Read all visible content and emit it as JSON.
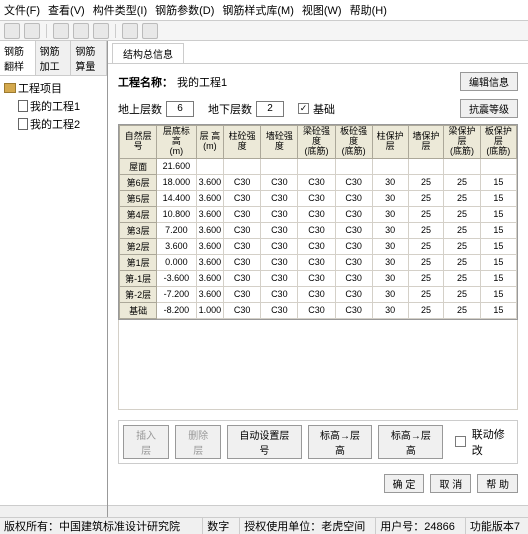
{
  "menu": [
    "文件(F)",
    "查看(V)",
    "构件类型(I)",
    "钢筋参数(D)",
    "钢筋样式库(M)",
    "视图(W)",
    "帮助(H)"
  ],
  "leftTabs": [
    "钢筋翻样",
    "钢筋加工",
    "钢筋算量"
  ],
  "treeRoot": "工程项目",
  "treeItems": [
    "我的工程1",
    "我的工程2"
  ],
  "rightTab": "结构总信息",
  "projLabel": "工程名称：",
  "projName": "我的工程1",
  "editBtn": "编辑信息",
  "aboveLabel": "地上层数",
  "aboveVal": "6",
  "belowLabel": "地下层数",
  "belowVal": "2",
  "baseLabel": "基础",
  "seismicBtn": "抗震等级",
  "headers": [
    "自然层号",
    "层底标高\n(m)",
    "层 高\n(m)",
    "柱砼强度",
    "墙砼强度",
    "梁砼强度\n(底筋)",
    "板砼强度\n(底筋)",
    "柱保护层",
    "墙保护层",
    "梁保护层\n(底筋)",
    "板保护层\n(底筋)"
  ],
  "rows": [
    {
      "h": "屋面",
      "c": [
        "21.600",
        "",
        "",
        "",
        "",
        "",
        "",
        "",
        "",
        ""
      ]
    },
    {
      "h": "第6层",
      "c": [
        "18.000",
        "3.600",
        "C30",
        "C30",
        "C30",
        "C30",
        "30",
        "25",
        "25",
        "15"
      ]
    },
    {
      "h": "第5层",
      "c": [
        "14.400",
        "3.600",
        "C30",
        "C30",
        "C30",
        "C30",
        "30",
        "25",
        "25",
        "15"
      ]
    },
    {
      "h": "第4层",
      "c": [
        "10.800",
        "3.600",
        "C30",
        "C30",
        "C30",
        "C30",
        "30",
        "25",
        "25",
        "15"
      ]
    },
    {
      "h": "第3层",
      "c": [
        "7.200",
        "3.600",
        "C30",
        "C30",
        "C30",
        "C30",
        "30",
        "25",
        "25",
        "15"
      ]
    },
    {
      "h": "第2层",
      "c": [
        "3.600",
        "3.600",
        "C30",
        "C30",
        "C30",
        "C30",
        "30",
        "25",
        "25",
        "15"
      ]
    },
    {
      "h": "第1层",
      "c": [
        "0.000",
        "3.600",
        "C30",
        "C30",
        "C30",
        "C30",
        "30",
        "25",
        "25",
        "15"
      ]
    },
    {
      "h": "第-1层",
      "c": [
        "-3.600",
        "3.600",
        "C30",
        "C30",
        "C30",
        "C30",
        "30",
        "25",
        "25",
        "15"
      ]
    },
    {
      "h": "第-2层",
      "c": [
        "-7.200",
        "3.600",
        "C30",
        "C30",
        "C30",
        "C30",
        "30",
        "25",
        "25",
        "15"
      ]
    },
    {
      "h": "基础",
      "c": [
        "-8.200",
        "1.000",
        "C30",
        "C30",
        "C30",
        "C30",
        "30",
        "25",
        "25",
        "15"
      ]
    }
  ],
  "insBtn": "插入层",
  "delBtn": "删除层",
  "autoBtn": "自动设置层号",
  "t2hBtn": "标高→层高",
  "h2tBtn": "标高→层高",
  "linkLabel": "联动修改",
  "okBtn": "确 定",
  "cancelBtn": "取 消",
  "helpBtn": "帮 助",
  "copyright": "版权所有：中国建筑标准设计研究院",
  "status": {
    "num": "数字",
    "auth": "授权使用单位：老虎空间",
    "user": "用户号：24866",
    "ver": "功能版本7"
  }
}
